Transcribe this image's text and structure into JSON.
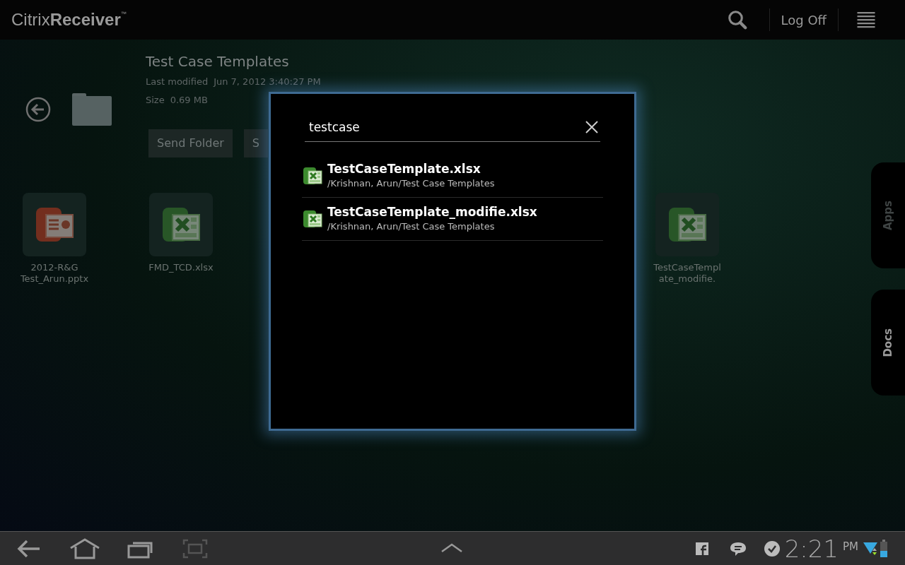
{
  "app_bar": {
    "logo_light": "Citrix",
    "logo_bold": "Receiver",
    "logo_mark": "™",
    "log_off": "Log Off"
  },
  "folder": {
    "title": "Test Case Templates",
    "modified_label": "Last modified",
    "modified": "Jun 7, 2012 3:40:27 PM",
    "size_label": "Size",
    "size": "0.69 MB",
    "buttons": [
      "Send Folder",
      "S"
    ]
  },
  "files": [
    {
      "name": "2012-R&G Test_Arun.pptx",
      "kind": "presentation"
    },
    {
      "name": "FMD_TCD.xlsx",
      "kind": "spreadsheet"
    },
    {
      "name": "TestCaseTempl ate_modifie.",
      "kind": "spreadsheet"
    }
  ],
  "side_tabs": [
    {
      "label": "Apps",
      "selected": false
    },
    {
      "label": "Docs",
      "selected": true
    }
  ],
  "search_dialog": {
    "query": "testcase",
    "results": [
      {
        "name": "TestCaseTemplate.xlsx",
        "path": "/Krishnan, Arun/Test Case Templates"
      },
      {
        "name": "TestCaseTemplate_modifie.xlsx",
        "path": "/Krishnan, Arun/Test Case Templates"
      }
    ]
  },
  "system_bar": {
    "time": "2:21",
    "ampm": "PM"
  }
}
